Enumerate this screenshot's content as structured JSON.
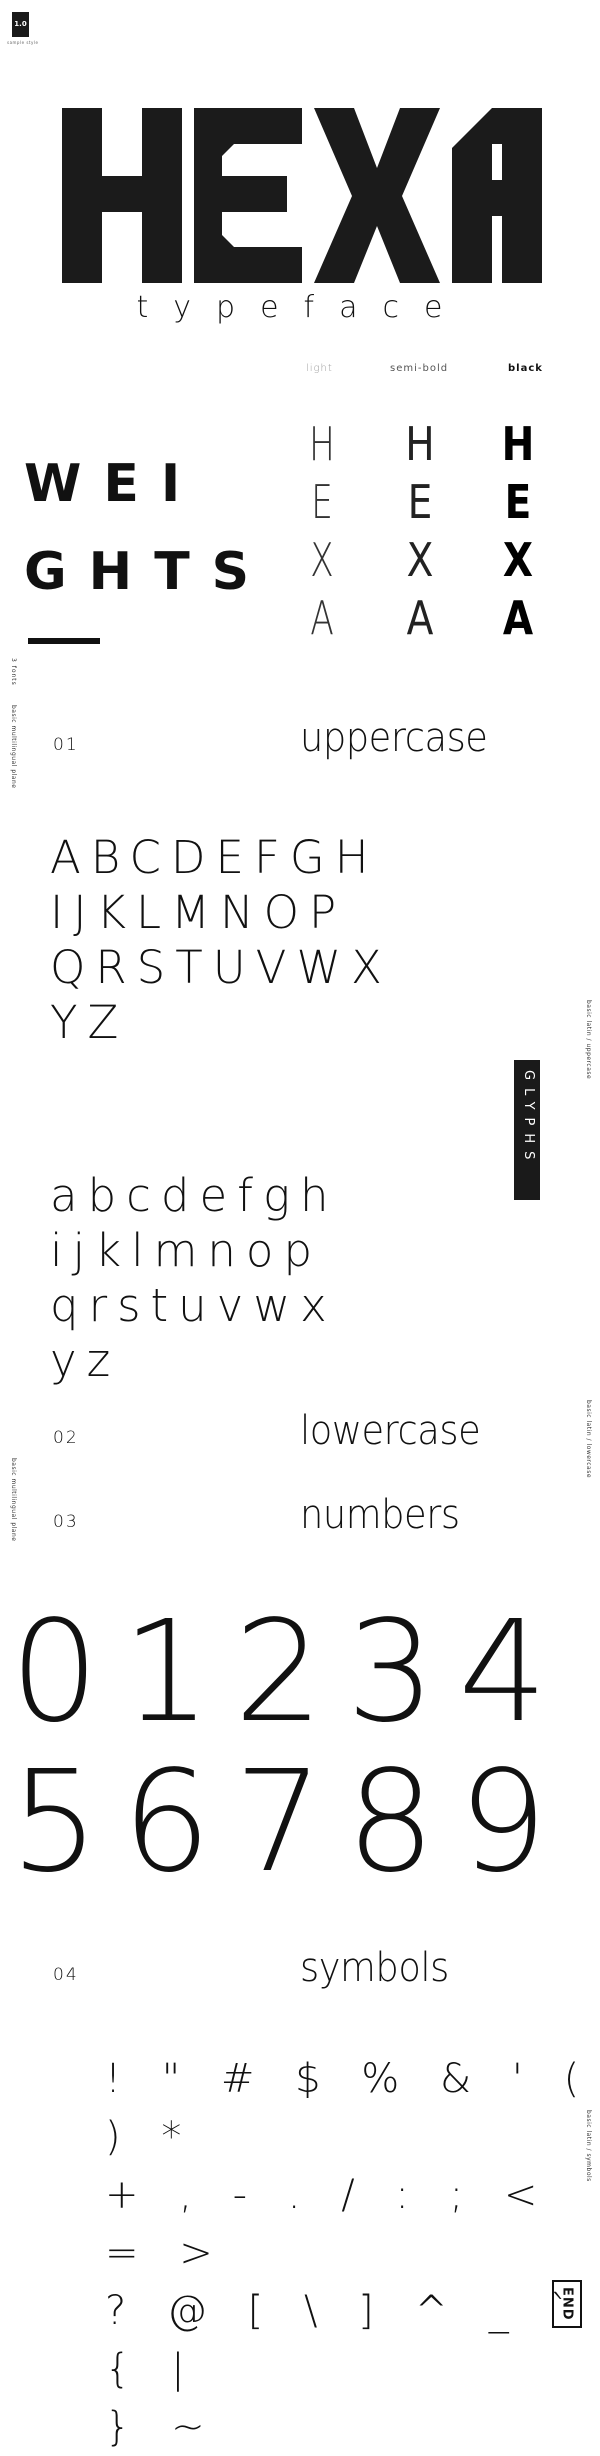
{
  "badge": {
    "version": "1.0",
    "subtitle": "sample style"
  },
  "hero": {
    "title": "HEXA",
    "subtitle": "typeface"
  },
  "weights": {
    "title_line1": "WEI",
    "title_line2": "GHTS",
    "labels": [
      "light",
      "semi-bold",
      "black"
    ],
    "letters": [
      "H",
      "E",
      "X",
      "A"
    ],
    "count_label": "3 fonts"
  },
  "sections": {
    "side_note": "basic multilingual plane",
    "uppercase": {
      "number": "01",
      "title": "uppercase",
      "rows": [
        "ABCDEFGH",
        "IJKLMNOP",
        "QRSTUVWX",
        "YZ"
      ],
      "side_label": "basic latin / uppercase"
    },
    "glyphs_label": "GLYPHS",
    "lowercase": {
      "number": "02",
      "title": "lowercase",
      "rows": [
        "abcdefgh",
        "ijklmnop",
        "qrstuvwx",
        "yz"
      ],
      "side_label": "basic latin / lowercase"
    },
    "numbers": {
      "number": "03",
      "title": "numbers",
      "rows": [
        "01234",
        "56789"
      ]
    },
    "symbols": {
      "number": "04",
      "title": "symbols",
      "rows": [
        "! \" # $ % & ' ( ) *",
        "+ , - . / : ; < = >",
        "? @ [ \\ ] ^ _ ` { |",
        "} ~"
      ],
      "side_label": "basic latin / symbols"
    }
  },
  "end_label": "END"
}
